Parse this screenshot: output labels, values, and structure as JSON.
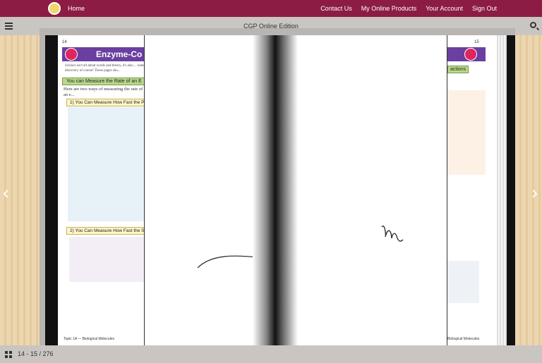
{
  "topnav": {
    "home": "Home",
    "links": [
      "Contact Us",
      "My Online Products",
      "Your Account",
      "Sign Out"
    ]
  },
  "toolbar": {
    "title": "CGP Online Edition"
  },
  "left_page": {
    "page_number": "14",
    "title": "Enzyme-Co",
    "intro": "Science isn't all about words and theory, it's also ... name of discovery of course!  These pages sho...",
    "section1": "You can Measure the Rate of an E",
    "section1_intro": "Here are two ways of measuring the rate of an e...",
    "sub1": "1) You Can Measure How Fast the Pro",
    "sub2": "2) You Can Measure How Fast the Sub",
    "footer": "Topic 1A — Biological Molecules"
  },
  "right_page": {
    "page_number": "15",
    "tab": "actions",
    "footer": "Biological Molecules"
  },
  "status": {
    "pages": "14 - 15 / 276"
  }
}
